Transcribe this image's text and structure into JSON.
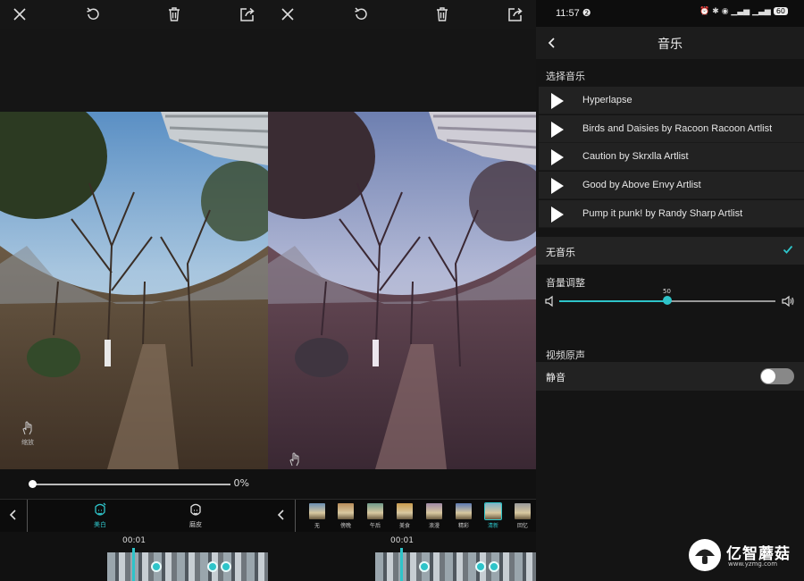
{
  "editor_left": {
    "pinch_label": "缩放",
    "slider_percent": 0.0,
    "slider_value": "0%",
    "tools": [
      {
        "label": "美白",
        "active": true
      },
      {
        "label": "磨皮",
        "active": false
      }
    ],
    "time": "00:01"
  },
  "editor_middle": {
    "pinch_label": "缩放",
    "filters": [
      {
        "label": "无",
        "color": "#6b8fb3"
      },
      {
        "label": "傍晚",
        "color": "#b88c5a"
      },
      {
        "label": "午后",
        "color": "#6f9a8a"
      },
      {
        "label": "美食",
        "color": "#c89b4e"
      },
      {
        "label": "浪漫",
        "color": "#a08aa6"
      },
      {
        "label": "精彩",
        "color": "#5d7ab3"
      },
      {
        "label": "清新",
        "color": "#7fb2c6",
        "selected": true
      },
      {
        "label": "回忆",
        "color": "#9a9a9a"
      }
    ],
    "time": "00:01"
  },
  "music": {
    "status_time": "11:57",
    "status_badge": "❷",
    "status_icons": "⏰ ✱ ◉ ▁▃▅ ▁▃▅",
    "battery": "60",
    "title": "音乐",
    "select_heading": "选择音乐",
    "tracks": [
      "Hyperlapse",
      "Birds and Daisies by Racoon Racoon Artlist",
      "Caution by Skrxlla Artlist",
      "Good by Above Envy Artlist",
      "Pump it punk! by Randy Sharp Artlist"
    ],
    "no_music": "无音乐",
    "volume_heading": "音量调整",
    "volume_value": "50",
    "original_heading": "视频原声",
    "mute_label": "静音",
    "mute_on": false
  },
  "watermark": {
    "name": "亿智蘑菇",
    "url": "www.yzmg.com"
  },
  "colors": {
    "accent": "#2ec4c9",
    "panel_bg": "#121212"
  }
}
